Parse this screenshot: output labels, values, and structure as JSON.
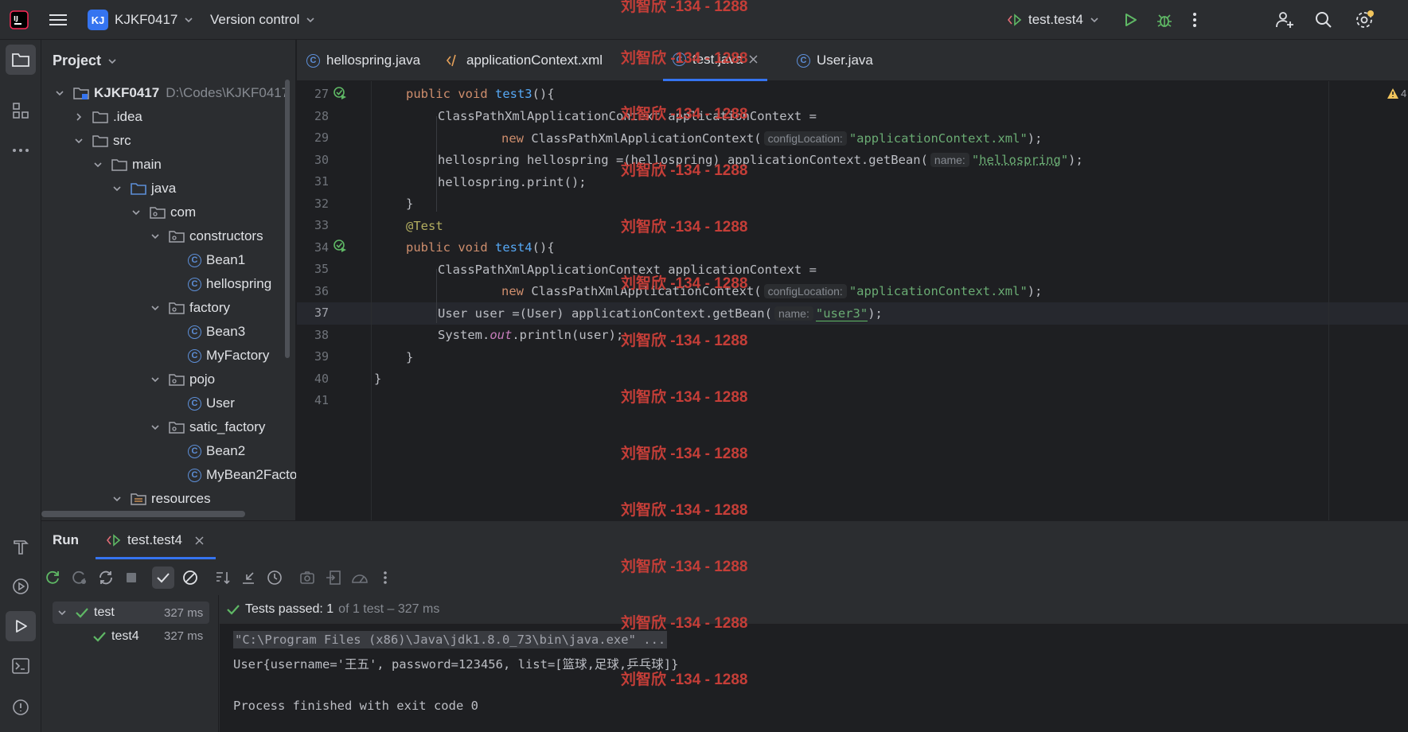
{
  "titlebar": {
    "project_badge": "KJ",
    "project_name": "KJKF0417",
    "version_control": "Version control",
    "run_config": "test.test4"
  },
  "project_panel": {
    "title": "Project",
    "tree": [
      {
        "label": "KJKF0417",
        "path": "D:\\Codes\\KJKF0417",
        "type": "module",
        "expanded": true
      },
      {
        "label": ".idea",
        "type": "folder",
        "expanded": false
      },
      {
        "label": "src",
        "type": "folder",
        "expanded": true
      },
      {
        "label": "main",
        "type": "folder",
        "expanded": true
      },
      {
        "label": "java",
        "type": "source-folder",
        "expanded": true
      },
      {
        "label": "com",
        "type": "package",
        "expanded": true
      },
      {
        "label": "constructors",
        "type": "package",
        "expanded": true
      },
      {
        "label": "Bean1",
        "type": "class"
      },
      {
        "label": "hellospring",
        "type": "class"
      },
      {
        "label": "factory",
        "type": "package",
        "expanded": true
      },
      {
        "label": "Bean3",
        "type": "class"
      },
      {
        "label": "MyFactory",
        "type": "class"
      },
      {
        "label": "pojo",
        "type": "package",
        "expanded": true
      },
      {
        "label": "User",
        "type": "class"
      },
      {
        "label": "satic_factory",
        "type": "package",
        "expanded": true
      },
      {
        "label": "Bean2",
        "type": "class"
      },
      {
        "label": "MyBean2Facto",
        "type": "class"
      },
      {
        "label": "resources",
        "type": "resources-folder",
        "expanded": true
      }
    ]
  },
  "editor_tabs": [
    {
      "label": "hellospring.java",
      "icon": "class-icon"
    },
    {
      "label": "applicationContext.xml",
      "icon": "xml-icon"
    },
    {
      "label": "test.java",
      "icon": "class-icon",
      "active": true
    },
    {
      "label": "User.java",
      "icon": "class-icon"
    }
  ],
  "editor": {
    "line_numbers": [
      "27",
      "28",
      "29",
      "30",
      "31",
      "32",
      "33",
      "34",
      "35",
      "36",
      "37",
      "38",
      "39",
      "40",
      "41"
    ],
    "current_line": "37",
    "warning_count": "4",
    "hint_config_location": "configLocation:",
    "hint_name": "name:",
    "lines": {
      "l27_kw": "public void ",
      "l27_fn": "test3",
      "l27_rest": "(){",
      "l28": "ClassPathXmlApplicationContext applicationContext =",
      "l29_kw": "new ",
      "l29_a": "ClassPathXmlApplicationContext(",
      "l29_str": "\"applicationContext.xml\"",
      "l29_end": ");",
      "l30_a": "hellospring hellospring =(hellospring) applicationContext.getBean(",
      "l30_q1": "\"",
      "l30_str": "hellospring",
      "l30_q2": "\"",
      "l30_end": ");",
      "l31": "hellospring.print();",
      "l32": "}",
      "l33": "@Test",
      "l34_kw": "public void ",
      "l34_fn": "test4",
      "l34_rest": "(){",
      "l35": "ClassPathXmlApplicationContext applicationContext =",
      "l36_kw": "new ",
      "l36_a": "ClassPathXmlApplicationContext(",
      "l36_str": "\"applicationContext.xml\"",
      "l36_end": ");",
      "l37_a": "User user =(User) applicationContext.getBean(",
      "l37_str": "\"user3\"",
      "l37_end": ");",
      "l38_a": "System.",
      "l38_fld": "out",
      "l38_b": ".println(user);",
      "l39": "}",
      "l40": "}"
    }
  },
  "watermark": "刘智欣 -134 - 1288",
  "run_panel": {
    "title": "Run",
    "tab_label": "test.test4",
    "status_bold": "Tests passed: 1",
    "status_rest": "of 1 test – 327 ms",
    "test_tree": [
      {
        "label": "test",
        "time": "327 ms",
        "selected": true
      },
      {
        "label": "test4",
        "time": "327 ms"
      }
    ],
    "console": [
      "\"C:\\Program Files (x86)\\Java\\jdk1.8.0_73\\bin\\java.exe\" ...",
      "User{username='王五', password=123456, list=[篮球,足球,乒乓球]}",
      "",
      "Process finished with exit code 0"
    ]
  },
  "colors": {
    "accent": "#3574f0",
    "success": "#5fb865",
    "watermark": "#c53e38",
    "string": "#6aab73",
    "keyword": "#cf8e6d"
  }
}
